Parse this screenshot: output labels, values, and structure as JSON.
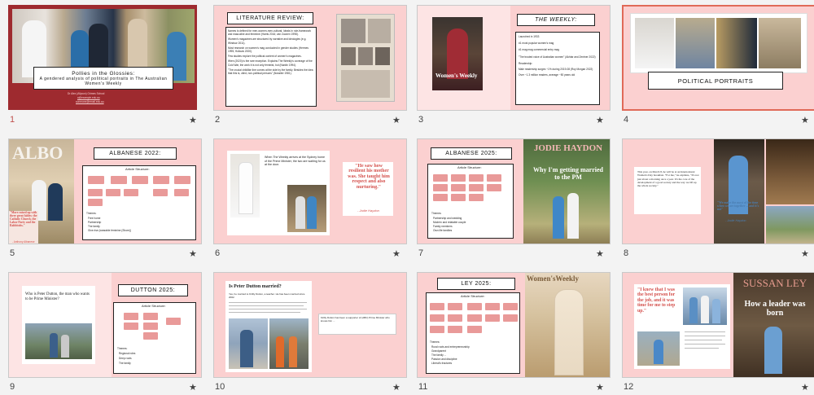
{
  "slides": [
    {
      "number": "1",
      "title": "Pollies in the Glossies:",
      "subtitle": "A gendered analysis of political portraits in The Australian Women's Weekly",
      "email1": "Dr Alex (Allyson) Grimes School",
      "email2": "a@example.edu.au",
      "email3": "someone@email.edu.au"
    },
    {
      "number": "2",
      "heading": "LITERATURE REVIEW:",
      "para1": "Names is defined for men-women-men-cultural. Ideals in role-framework and masculine and feminine (Harris 2016; van Zoonen 1998).",
      "para2": "Women's magazines are structured by narrative and ideologies (e.g. Windsor 2011).",
      "para3": "Most research on women's mag conducted in gender studies (Hermes 1995; Hollows 2000).",
      "para4": "Few studies explore the political content of women's magazines.",
      "para5": "Wren (2020) is the rare exception. Explains The Weekly's coverage of the Cold War, the work it is not only feminist, but (Nardin 1994).",
      "para6": "\"The crucial childlike line comes at the side by the family. Besides the idea that this is, cited, non-political persons\" (Nossiter 1981)."
    },
    {
      "number": "3",
      "heading": "THE WEEKLY:",
      "items": [
        "Launched in 1933",
        "#1 most popular women's mag",
        "#1 mag mag commercial entry mag",
        "\"The trusted voice of Australian women\" (Akhtar and Zentner 2022)",
        "Readership:",
        "Male readership surges ~1% during 2019-08 (Roy Morgan 2022)",
        "Over ~1.3 million readers, average ~50 years old"
      ],
      "cover": "Women's Weekly"
    },
    {
      "number": "4",
      "heading": "POLITICAL PORTRAITS"
    },
    {
      "number": "5",
      "heading": "ALBANESE 2022:",
      "cover_title": "ALBO",
      "structure": "Article Structure:",
      "themes_title": "Themes:",
      "themes": [
        "Free home",
        "Partnership",
        "The family",
        "Give rise (wearable feminine (Shore))"
      ],
      "quote": "\"More raised up with three great fables: the Catholic Church, the Labor Party and the Rabbitohs.\"",
      "quote_by": "- Anthony Albanese"
    },
    {
      "number": "6",
      "text": "When The Weekly arrives at the Sydney home of the Prime Minister, the two are waiting for us at the door.",
      "quote": "\"He saw how resilient his mother was. She taught him respect and also nurturing.\"",
      "quote_by": "- Jodie Haydon"
    },
    {
      "number": "7",
      "heading": "ALBANESE 2025:",
      "structure": "Article Structure:",
      "themes_title": "Themes:",
      "themes": [
        "Partnership and wedding",
        "Modern and relatable couple",
        "Family members",
        "Own life families"
      ],
      "cover_name": "JODIE HAYDON",
      "cover_quote": "Why I'm getting married to the PM"
    },
    {
      "number": "8",
      "text": "This year, on March 8, he will be at an International Women's Day breakfast. \"For me,\" he explains, \"It's not just about a morning once a year. It's the core of the development of a good society and the way we lift up the whole society.\"",
      "quote": "\"We make the most of the time when we are together ... and it's not\"",
      "quote_by": "- Jodie Haydon"
    },
    {
      "number": "9",
      "heading": "DUTTON 2025:",
      "article_title": "Who is Peter Dutton, the man who wants to be Prime Minister?",
      "structure": "Article Structure:",
      "themes_title": "Themes:",
      "themes": [
        "Regional roles",
        "Deep roots",
        "The family"
      ]
    },
    {
      "number": "10",
      "article_title": "Is Peter Dutton married?",
      "body": "Yes, he married to Kirilly Dutton, a teacher. He has been married since 2002.",
      "side_text": "Kirilly Dutton has been a supporter of (ABC) Prime Minister who knows him ..."
    },
    {
      "number": "11",
      "heading": "LEY 2025:",
      "structure": "Article Structure:",
      "themes_title": "Themes:",
      "themes": [
        "Rural roots and entrepreneurship",
        "Grandparent",
        "The family ...",
        "Passion and discipline",
        "Liberal's fractures"
      ],
      "cover": "Women'sWeekly"
    },
    {
      "number": "12",
      "quote": "\"I knew that I was the best person for the job, and it was time for me to step up.\"",
      "cover_name": "SUSSAN LEY",
      "cover_quote": "How a leader was born"
    }
  ],
  "star_glyph": "★",
  "colors": {
    "slide_bg": "#fbd0d0",
    "chip": "#e99a99",
    "selected_border": "#9e2a2f",
    "quote": "#d4504c"
  }
}
